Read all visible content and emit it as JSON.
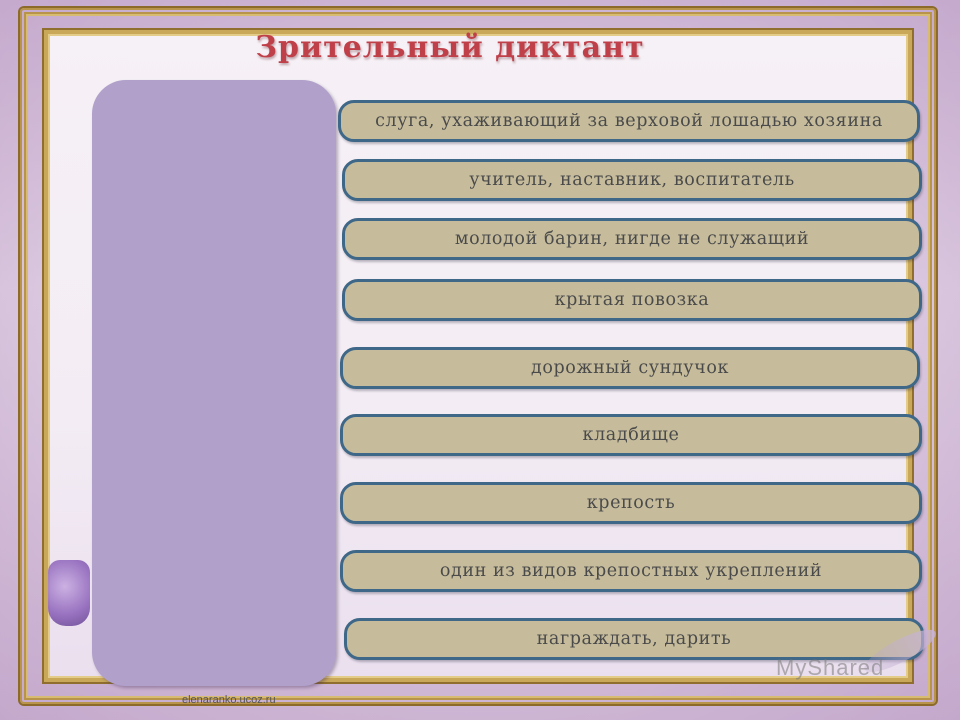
{
  "title": "Зрительный диктант",
  "answer_panel": {
    "color": "#b0a0ca"
  },
  "items": [
    "слуга, ухаживающий за верховой лошадью хозяина",
    "учитель, наставник, воспитатель",
    "молодой барин, нигде не служащий",
    "крытая повозка",
    "дорожный сундучок",
    "кладбище",
    "крепость",
    "один из видов крепостных укреплений",
    "награждать, дарить"
  ],
  "watermark_left": "elenaranko.ucoz.ru",
  "watermark_right": "MyShared",
  "colors": {
    "item_fill": "#c6bc9c",
    "item_border": "#3f6787",
    "title": "#c0404a",
    "frame": "#b8944a"
  }
}
